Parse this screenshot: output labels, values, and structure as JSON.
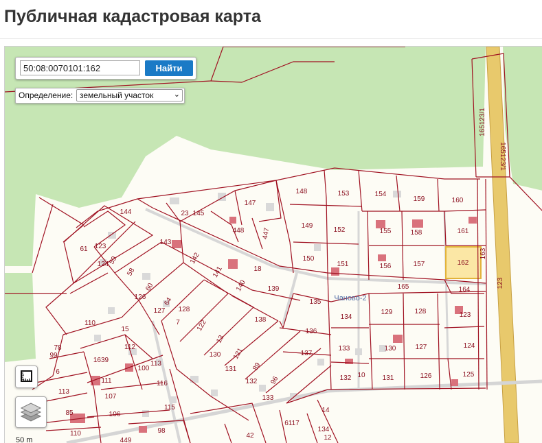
{
  "page": {
    "title": "Публичная кадастровая карта"
  },
  "search": {
    "value": "50:08:0070101:162",
    "button_label": "Найти"
  },
  "definition": {
    "label": "Определение:",
    "selected": "земельный участок"
  },
  "map": {
    "colors": {
      "forest": "#c6e6b4",
      "parcel_border": "#a01222",
      "building": "#d9d9d9",
      "building_red": "#d9727c",
      "road": "#e8c96c",
      "selected_fill": "#fbe7a5"
    },
    "selected_parcel": "162",
    "settlement_label": "Чаново-2",
    "scale_label": "50 m",
    "parcel_labels": [
      {
        "text": "148"
      },
      {
        "text": "153"
      },
      {
        "text": "154"
      },
      {
        "text": "159"
      },
      {
        "text": "160"
      },
      {
        "text": "147"
      },
      {
        "text": "144"
      },
      {
        "text": "23"
      },
      {
        "text": "145"
      },
      {
        "text": "448"
      },
      {
        "text": "447"
      },
      {
        "text": "149"
      },
      {
        "text": "152"
      },
      {
        "text": "155"
      },
      {
        "text": "158"
      },
      {
        "text": "161"
      },
      {
        "text": "163"
      },
      {
        "text": "61"
      },
      {
        "text": "123"
      },
      {
        "text": "124"
      },
      {
        "text": "59"
      },
      {
        "text": "143"
      },
      {
        "text": "142"
      },
      {
        "text": "150"
      },
      {
        "text": "151"
      },
      {
        "text": "156"
      },
      {
        "text": "157"
      },
      {
        "text": "162"
      },
      {
        "text": "58"
      },
      {
        "text": "141"
      },
      {
        "text": "18"
      },
      {
        "text": "140"
      },
      {
        "text": "139"
      },
      {
        "text": "165"
      },
      {
        "text": "164"
      },
      {
        "text": "126"
      },
      {
        "text": "60"
      },
      {
        "text": "64"
      },
      {
        "text": "127"
      },
      {
        "text": "128"
      },
      {
        "text": "135"
      },
      {
        "text": "129"
      },
      {
        "text": "128"
      },
      {
        "text": "123"
      },
      {
        "text": "110"
      },
      {
        "text": "7"
      },
      {
        "text": "122"
      },
      {
        "text": "138"
      },
      {
        "text": "134"
      },
      {
        "text": "15"
      },
      {
        "text": "13"
      },
      {
        "text": "136"
      },
      {
        "text": "78"
      },
      {
        "text": "99"
      },
      {
        "text": "112"
      },
      {
        "text": "130"
      },
      {
        "text": "121"
      },
      {
        "text": "133"
      },
      {
        "text": "130"
      },
      {
        "text": "127"
      },
      {
        "text": "124"
      },
      {
        "text": "6"
      },
      {
        "text": "1639"
      },
      {
        "text": "100"
      },
      {
        "text": "113"
      },
      {
        "text": "131"
      },
      {
        "text": "89"
      },
      {
        "text": "137"
      },
      {
        "text": "113"
      },
      {
        "text": "111"
      },
      {
        "text": "116"
      },
      {
        "text": "132"
      },
      {
        "text": "96"
      },
      {
        "text": "132"
      },
      {
        "text": "10"
      },
      {
        "text": "131"
      },
      {
        "text": "126"
      },
      {
        "text": "125"
      },
      {
        "text": "107"
      },
      {
        "text": "85"
      },
      {
        "text": "106"
      },
      {
        "text": "115"
      },
      {
        "text": "133"
      },
      {
        "text": "14"
      },
      {
        "text": "110"
      },
      {
        "text": "98"
      },
      {
        "text": "449"
      },
      {
        "text": "42"
      },
      {
        "text": "6117"
      },
      {
        "text": "134"
      },
      {
        "text": "12"
      },
      {
        "text": "165123/1"
      },
      {
        "text": "165123/1"
      },
      {
        "text": "123"
      }
    ]
  },
  "controls": {
    "ruler_icon": "ruler-icon",
    "layers_icon": "layers-icon"
  }
}
